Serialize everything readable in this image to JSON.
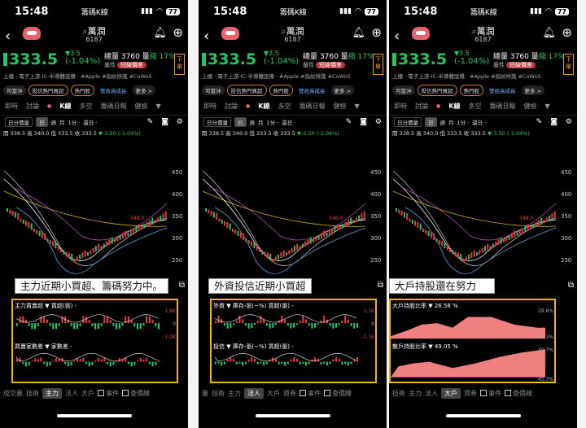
{
  "status": {
    "time": "15:48",
    "carrier": "籌碼K線",
    "battery": "77"
  },
  "stock": {
    "name": "萬潤",
    "code": "6187",
    "price": "333.5",
    "change": "▼3.5",
    "change_pct": "(-1.04%)",
    "volume_label": "總量",
    "volume": "3760",
    "amount_label": "量",
    "amount": "縮 17%",
    "attr_label": "屬性",
    "attr_badge": "短線價差",
    "sell_label": "下單"
  },
  "category": "上櫃 · 電子上游-IC-半導體設備 · #Apple #指紋辨識 #CoWoS",
  "tags": [
    "可當沖",
    "投信熱門買超",
    "熱門股",
    "營收高成長",
    "更多 >"
  ],
  "tabs": [
    "即時",
    "討論",
    "K線",
    "多空",
    "籌碼日報",
    "健檢",
    "▼"
  ],
  "toolbar": {
    "period": "日分價量",
    "day": "日",
    "week": "週",
    "month": "月",
    "min": "1分 ·",
    "rights": "還日 ·"
  },
  "ohlc": {
    "text": "開 338.5 高 340.0 低 333.5 收 333.5",
    "chg": "▼-3.50 (-1.04%)"
  },
  "axis": {
    "y": [
      "450",
      "400",
      "350",
      "300",
      "250"
    ],
    "ma_label": "348.0"
  },
  "panels": [
    {
      "caption": "主力近期小買超、籌碼努力中。",
      "ind1": "主力買賣超 ▼ 買超(張) -",
      "ind2": "買賣家數差 ▼ 家數差 -",
      "bottom": [
        "成交量",
        "技術",
        "主力",
        "法人",
        "大戶"
      ],
      "active": "主力",
      "v1": [
        "1.8K",
        "0",
        "-1.0K"
      ],
      "v2": [
        "",
        "",
        ""
      ]
    },
    {
      "caption": "外資投信近期小買超",
      "ind1": "外資 ▼ 庫存-張(~%) 買超(張) -",
      "ind2": "投信 ▼ 庫存-張(~%) 買超(張) -",
      "bottom": [
        "量",
        "技術",
        "主力",
        "法人",
        "大戶",
        "資券"
      ],
      "active": "法人",
      "v1": [
        "1.1K",
        "0",
        "-1.1K"
      ],
      "v2": [
        "",
        "",
        ""
      ]
    },
    {
      "caption": "大戶持股還在努力",
      "ind1": "大戶持股比率 ▼ 26.58 %",
      "ind2": "散戶持股比率 ▼ 49.05 %",
      "bottom": [
        "技術",
        "主力",
        "法人",
        "大戶",
        "資券"
      ],
      "active": "大戶",
      "v1": [
        "29.6%",
        "",
        "26.3%"
      ],
      "v2": [
        "49.7%",
        "",
        "45.7%"
      ]
    }
  ],
  "checks": [
    "事件",
    "查價線"
  ],
  "colors": {
    "up": "#e23b3b",
    "down": "#22c55e",
    "accent": "#f5b301"
  }
}
